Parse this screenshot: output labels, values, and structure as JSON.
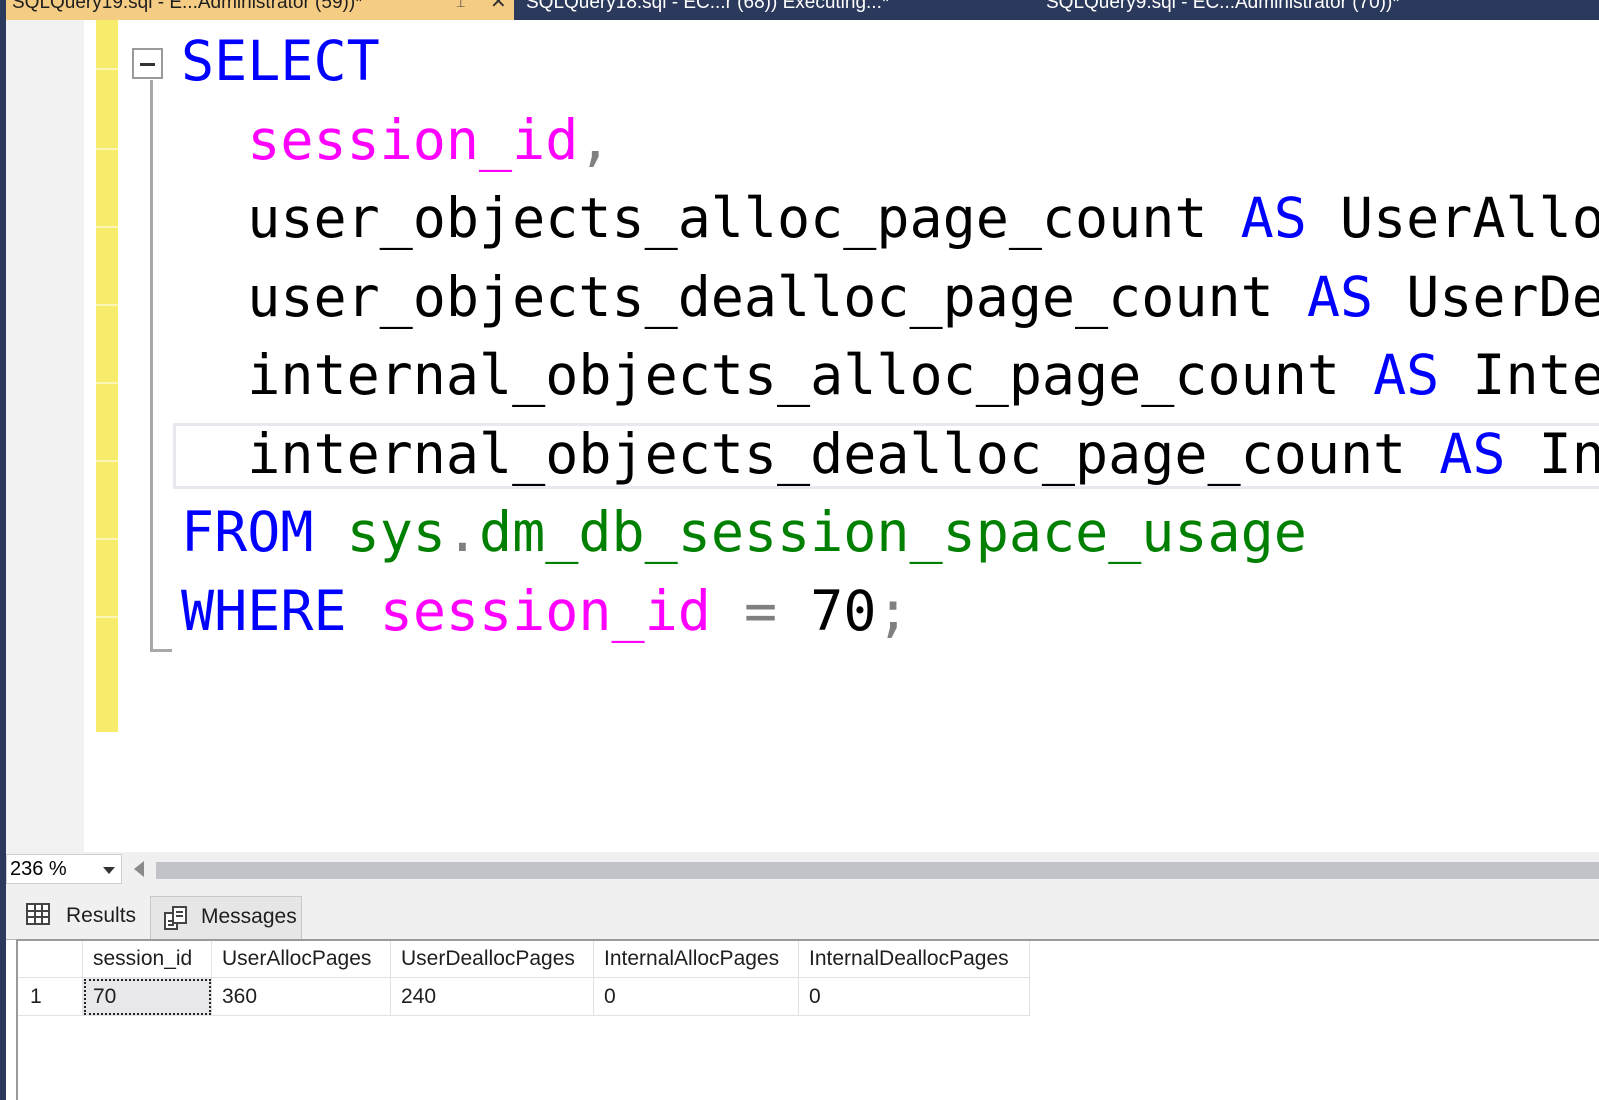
{
  "tabs": [
    {
      "title": "SQLQuery19.sql - E...Administrator (59))*",
      "active": true
    },
    {
      "title": "SQLQuery18.sql - EC...r (68)) Executing...*",
      "active": false
    },
    {
      "title": "SQLQuery9.sql - EC...Administrator (70))*",
      "active": false
    }
  ],
  "editor": {
    "lines": [
      [
        {
          "t": "SELECT",
          "c": "kw"
        }
      ],
      [
        {
          "t": "  "
        },
        {
          "t": "session_id",
          "c": "col"
        },
        {
          "t": ",",
          "c": "op"
        }
      ],
      [
        {
          "t": "  user_objects_alloc_page_count "
        },
        {
          "t": "AS",
          "c": "kw"
        },
        {
          "t": " UserAllocPages"
        },
        {
          "t": ",",
          "c": "op"
        }
      ],
      [
        {
          "t": "  user_objects_dealloc_page_count "
        },
        {
          "t": "AS",
          "c": "kw"
        },
        {
          "t": " UserDeallocPages"
        },
        {
          "t": ",",
          "c": "op"
        }
      ],
      [
        {
          "t": "  internal_objects_alloc_page_count "
        },
        {
          "t": "AS",
          "c": "kw"
        },
        {
          "t": " InternalAllocPages"
        },
        {
          "t": ",",
          "c": "op"
        }
      ],
      [
        {
          "t": "  internal_objects_dealloc_page_count "
        },
        {
          "t": "AS",
          "c": "kw"
        },
        {
          "t": " InternalDeallocPages"
        }
      ],
      [
        {
          "t": "FROM",
          "c": "kw"
        },
        {
          "t": " "
        },
        {
          "t": "sys",
          "c": "obj"
        },
        {
          "t": ".",
          "c": "op"
        },
        {
          "t": "dm_db_session_space_usage",
          "c": "obj"
        }
      ],
      [
        {
          "t": "WHERE",
          "c": "kw"
        },
        {
          "t": " "
        },
        {
          "t": "session_id",
          "c": "col"
        },
        {
          "t": " "
        },
        {
          "t": "=",
          "c": "op"
        },
        {
          "t": " 70"
        },
        {
          "t": ";",
          "c": "op"
        }
      ]
    ]
  },
  "zoom": {
    "value": "236 %"
  },
  "results_tabs": {
    "results_label": "Results",
    "messages_label": "Messages"
  },
  "grid": {
    "columns": [
      "session_id",
      "UserAllocPages",
      "UserDeallocPages",
      "InternalAllocPages",
      "InternalDeallocPages"
    ],
    "rows": [
      {
        "num": "1",
        "cells": [
          "70",
          "360",
          "240",
          "0",
          "0"
        ]
      }
    ]
  },
  "colors": {
    "keyword": "#0000ff",
    "column": "#ff00ff",
    "system_object": "#008000",
    "operator": "#808080",
    "active_tab": "#f5cc84",
    "tab_strip": "#2b3a5c",
    "change_bar": "#f8ec6c"
  }
}
